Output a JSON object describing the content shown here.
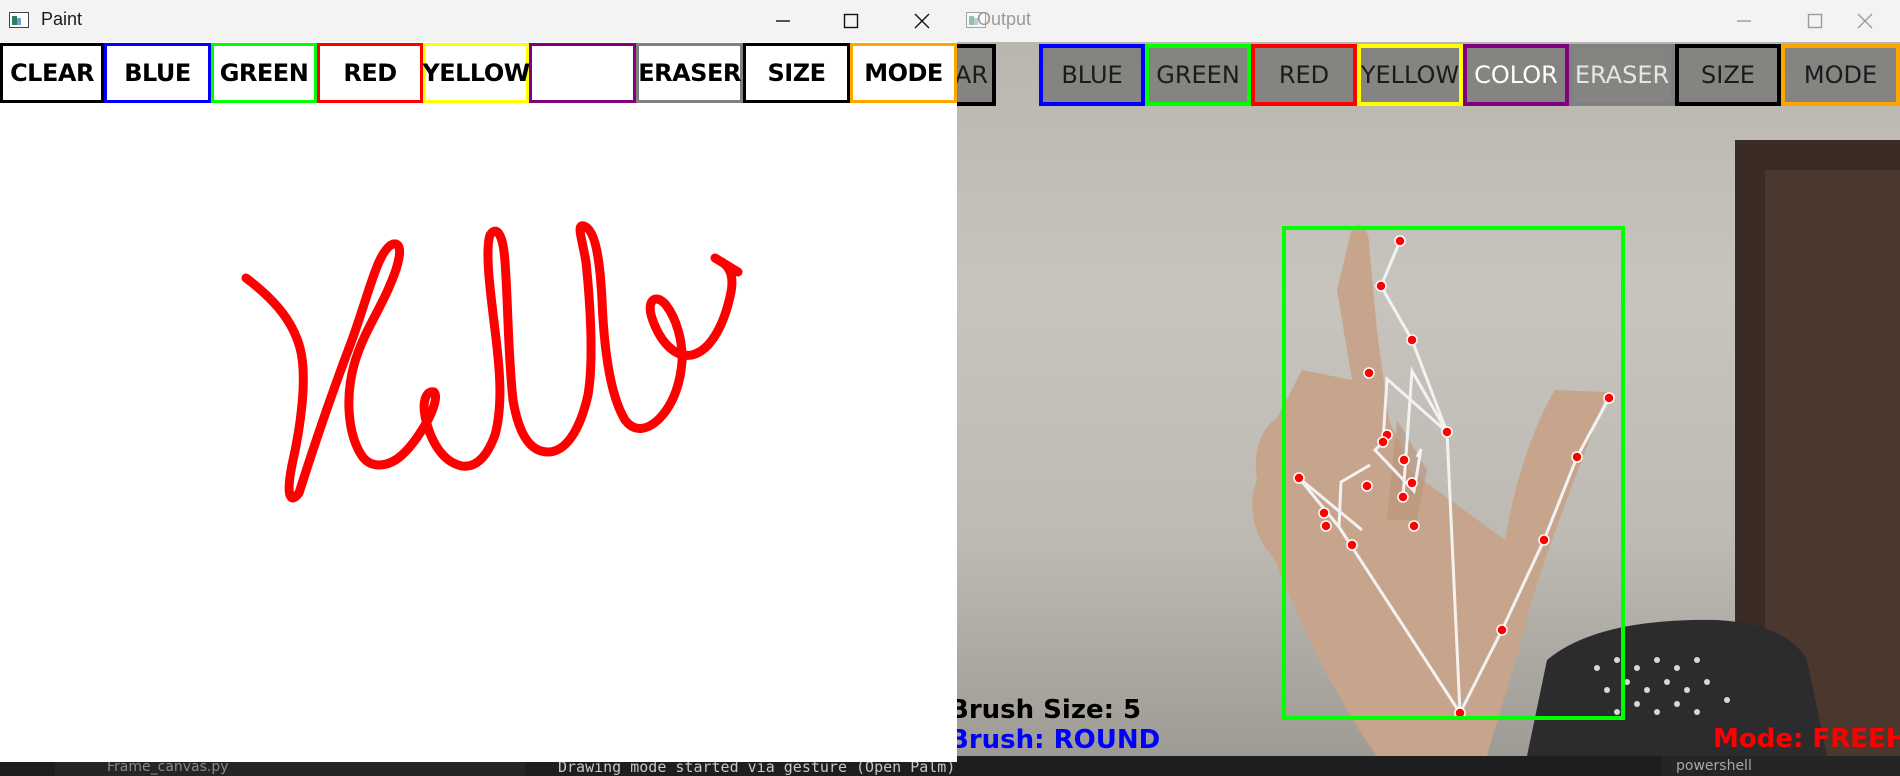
{
  "paint_window": {
    "title": "Paint",
    "buttons": [
      {
        "label": "CLEAR",
        "border": "#000000"
      },
      {
        "label": "BLUE",
        "border": "#0000ff"
      },
      {
        "label": "GREEN",
        "border": "#00ff00"
      },
      {
        "label": "RED",
        "border": "#ff0000"
      },
      {
        "label": "YELLOW",
        "border": "#ffff00"
      },
      {
        "label": "",
        "border": "#800080"
      },
      {
        "label": "ERASER",
        "border": "#808080"
      },
      {
        "label": "SIZE",
        "border": "#000000"
      },
      {
        "label": "MODE",
        "border": "#ffa500"
      }
    ],
    "stroke_color": "#ff0000"
  },
  "output_window": {
    "title": "Output",
    "buttons": [
      {
        "label": "CLEAR",
        "border": "#000000"
      },
      {
        "label": "BLUE",
        "border": "#0000ff"
      },
      {
        "label": "GREEN",
        "border": "#00ff00"
      },
      {
        "label": "RED",
        "border": "#ff0000"
      },
      {
        "label": "YELLOW",
        "border": "#ffff00"
      },
      {
        "label": "COLOR",
        "border": "#800080"
      },
      {
        "label": "ERASER",
        "border": "#808080"
      },
      {
        "label": "SIZE",
        "border": "#000000"
      },
      {
        "label": "MODE",
        "border": "#ffa500"
      }
    ],
    "brush_size_text": "Brush Size: 5",
    "brush_text": "Brush: ROUND",
    "mode_text": "Mode: FREEHAND",
    "detection_box_color": "#00ff00",
    "landmark_color": "#ff0000"
  },
  "taskbar": {
    "file_tab": "Frame_canvas.py",
    "terminal_line": "Drawing mode started via gesture (Open Palm)",
    "shell_tab": "powershell"
  },
  "icons": {
    "minimize": "minimize-icon",
    "maximize": "maximize-icon",
    "close": "close-icon"
  }
}
